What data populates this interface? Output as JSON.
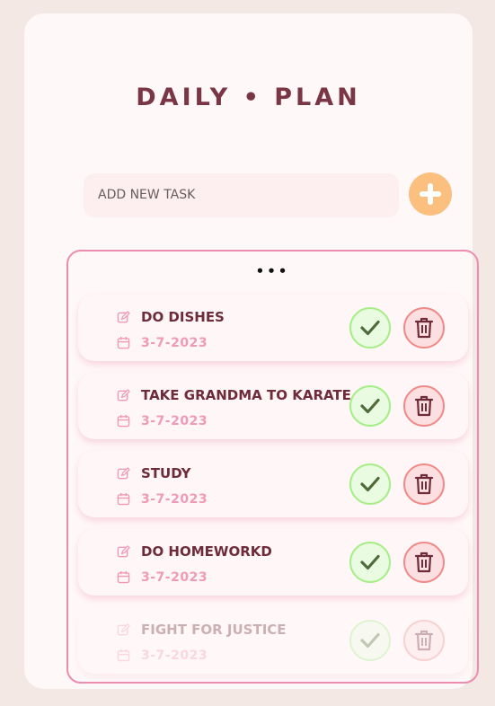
{
  "header": {
    "title": "DAILY • PLAN"
  },
  "add_task": {
    "placeholder": "ADD NEW TASK"
  },
  "list": {
    "menu_dots": "•••",
    "tasks": [
      {
        "name": "DO DISHES",
        "date": "3-7-2023"
      },
      {
        "name": "TAKE GRANDMA TO KARATE",
        "date": "3-7-2023"
      },
      {
        "name": "STUDY",
        "date": "3-7-2023"
      },
      {
        "name": "DO HOMEWORKD",
        "date": "3-7-2023"
      },
      {
        "name": "FIGHT FOR JUSTICE",
        "date": "3-7-2023"
      }
    ]
  },
  "colors": {
    "background": "#f3e8e3",
    "card": "#fff8f9",
    "title": "#7a3645",
    "accent_add": "#fbbf7f",
    "list_border": "#ec8cb0",
    "task_name": "#6e2b3a",
    "task_date": "#f09ab8",
    "check": "#a6ee86",
    "delete": "#f08a88"
  },
  "icons": {
    "add": "plus-icon",
    "edit": "pencil-icon",
    "date": "calendar-icon",
    "complete": "checkmark-icon",
    "delete": "trash-icon"
  }
}
